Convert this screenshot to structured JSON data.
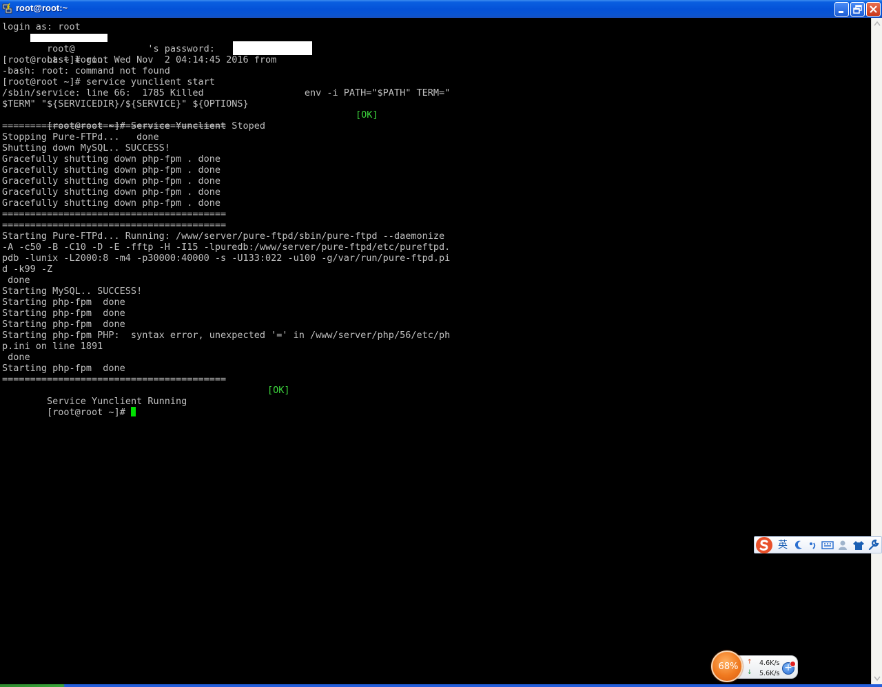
{
  "window": {
    "title": "root@root:~"
  },
  "terminal": {
    "lines": [
      "login as: root",
      "root@             's password:",
      "Last login: Wed Nov  2 04:14:45 2016 from",
      "[root@root ~]# root",
      "-bash: root: command not found",
      "[root@root ~]# service yunclient start",
      "/sbin/service: line 66:  1785 Killed                  env -i PATH=\"$PATH\" TERM=\"",
      "$TERM\" \"${SERVICEDIR}/${SERVICE}\" ${OPTIONS}",
      "[root@root ~]# Service Yunclient Stoped",
      "========================================",
      "Stopping Pure-FTPd...   done",
      "Shutting down MySQL.. SUCCESS!",
      "Gracefully shutting down php-fpm . done",
      "Gracefully shutting down php-fpm . done",
      "Gracefully shutting down php-fpm . done",
      "Gracefully shutting down php-fpm . done",
      "Gracefully shutting down php-fpm . done",
      "========================================",
      "========================================",
      "Starting Pure-FTPd... Running: /www/server/pure-ftpd/sbin/pure-ftpd --daemonize",
      "-A -c50 -B -C10 -D -E -fftp -H -I15 -lpuredb:/www/server/pure-ftpd/etc/pureftpd.",
      "pdb -lunix -L2000:8 -m4 -p30000:40000 -s -U133:022 -u100 -g/var/run/pure-ftpd.pi",
      "d -k99 -Z",
      " done",
      "Starting MySQL.. SUCCESS!",
      "Starting php-fpm  done",
      "Starting php-fpm  done",
      "Starting php-fpm  done",
      "Starting php-fpm PHP:  syntax error, unexpected '=' in /www/server/php/56/etc/ph",
      "p.ini on line 1891",
      " done",
      "Starting php-fpm  done",
      "========================================",
      "Service Yunclient Running",
      "[root@root ~]# "
    ],
    "ok_label_1": "[OK]",
    "ok_label_2": "[OK]",
    "colors": {
      "background": "#000000",
      "text": "#c0c0c0",
      "ok": "#3dd63d",
      "cursor": "#00e000"
    }
  },
  "ime": {
    "mode_label": "英"
  },
  "net_widget": {
    "percent": "68%",
    "upload_speed": "4.6K/s",
    "download_speed": "5.6K/s"
  }
}
